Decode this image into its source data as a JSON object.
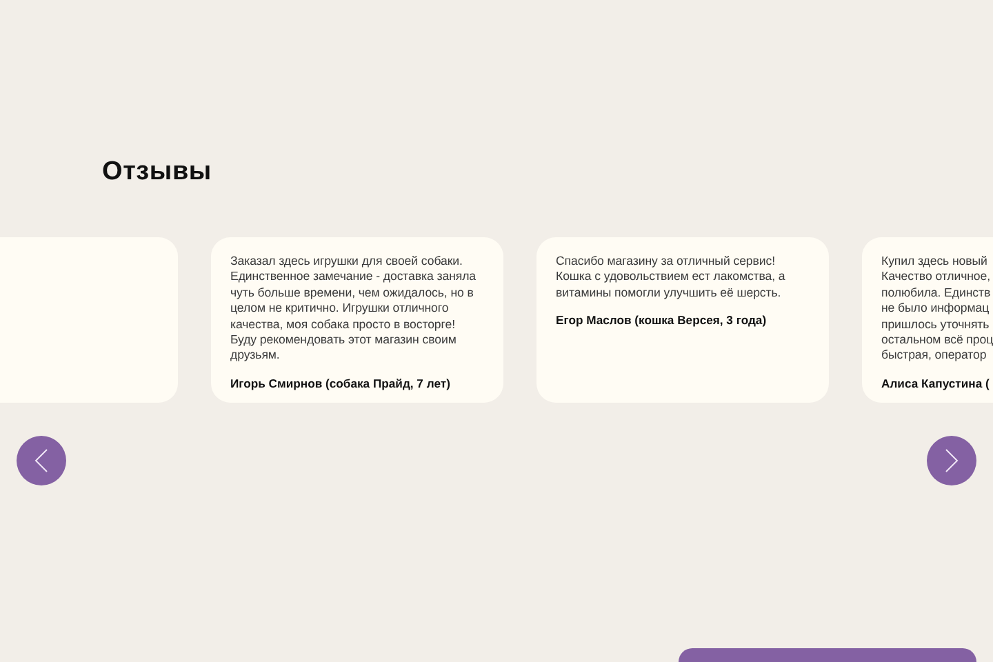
{
  "section_title": "Отзывы",
  "reviews": [
    {
      "kind": "blank"
    },
    {
      "lines": [
        "Заказал здесь игрушки для своей собаки.",
        "Единственное замечание - доставка заняла",
        "чуть больше времени, чем ожидалось, но в",
        "целом не критично. Игрушки отличного",
        "качества, моя собака просто в восторге!",
        "Буду рекомендовать этот магазин своим",
        "друзьям."
      ],
      "author": "Игорь Смирнов (собака Прайд, 7 лет)"
    },
    {
      "lines": [
        "Спасибо магазину за отличный сервис!",
        "Кошка с удовольствием ест лакомства, а",
        "витамины помогли улучшить её шерсть."
      ],
      "author": "Егор Маслов (кошка Версея, 3 года)"
    },
    {
      "lines": [
        "Купил здесь новый",
        "Качество отличное,",
        "полюбила. Единств",
        "не было информац",
        "пришлось уточнять",
        "остальном всё проц",
        "быстрая, оператор"
      ],
      "author": "Алиса Капустина ("
    }
  ]
}
